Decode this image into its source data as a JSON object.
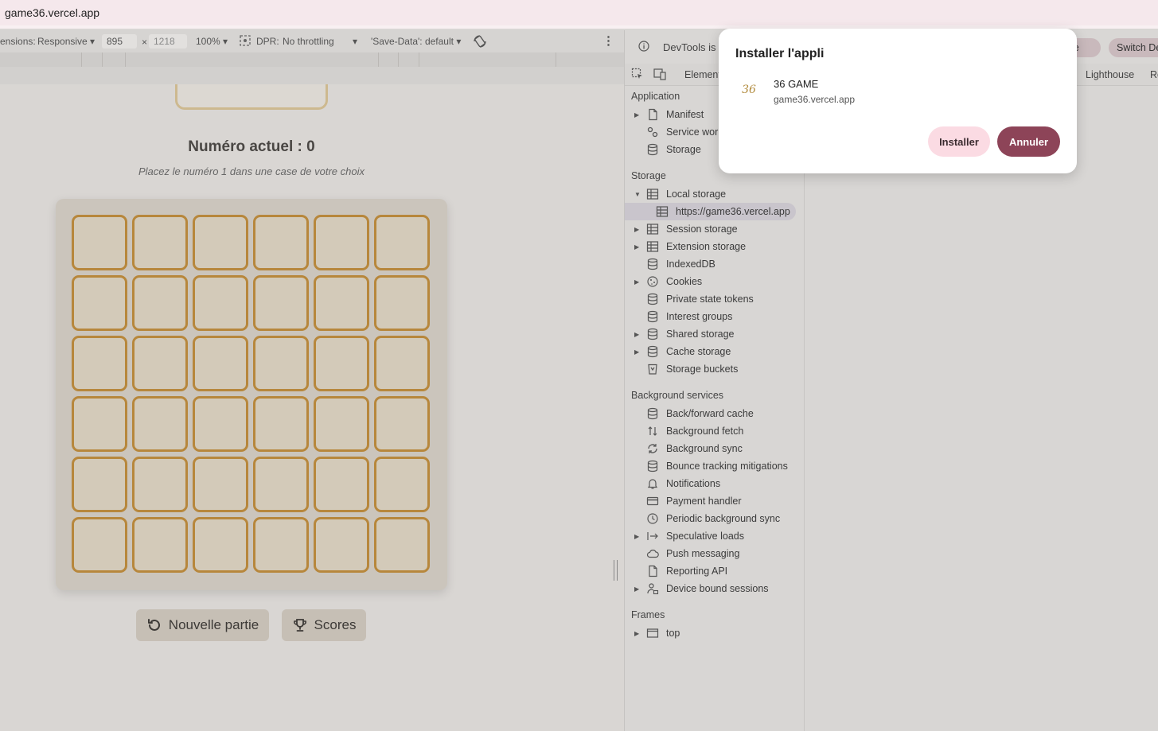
{
  "browser": {
    "url": "game36.vercel.app"
  },
  "emulation": {
    "dimensions_label": "ensions:",
    "device": "Responsive",
    "width": "895",
    "times": "×",
    "height": "1218",
    "zoom": "100%",
    "dpr_label": "DPR:",
    "throttling": "No throttling",
    "save_data": "'Save-Data': default"
  },
  "game": {
    "current_number": "Numéro actuel : 0",
    "instruction": "Placez le numéro 1 dans une case de votre choix",
    "grid_rows": 6,
    "grid_cols": 6,
    "new_game_label": "Nouvelle partie",
    "scores_label": "Scores"
  },
  "devtools": {
    "notice": "DevTools is r",
    "pill_1": "age",
    "pill_2": "Switch De",
    "tabs": {
      "elements": "Element",
      "lighthouse": "Lighthouse",
      "more": "Re"
    },
    "sections": {
      "application": "Application",
      "storage": "Storage",
      "background": "Background services",
      "frames": "Frames"
    },
    "application_items": [
      {
        "label": "Manifest",
        "icon": "file-icon",
        "arrow": true
      },
      {
        "label": "Service work",
        "icon": "gears-icon",
        "arrow": false
      },
      {
        "label": "Storage",
        "icon": "database-icon",
        "arrow": false
      }
    ],
    "storage_items": [
      {
        "label": "Local storage",
        "icon": "table-icon",
        "arrow": "open"
      },
      {
        "label": "https://game36.vercel.app",
        "icon": "table-icon",
        "arrow": false,
        "child": true,
        "selected": true
      },
      {
        "label": "Session storage",
        "icon": "table-icon",
        "arrow": true
      },
      {
        "label": "Extension storage",
        "icon": "table-icon",
        "arrow": true
      },
      {
        "label": "IndexedDB",
        "icon": "database-icon",
        "arrow": false
      },
      {
        "label": "Cookies",
        "icon": "cookie-icon",
        "arrow": true
      },
      {
        "label": "Private state tokens",
        "icon": "database-icon",
        "arrow": false
      },
      {
        "label": "Interest groups",
        "icon": "database-icon",
        "arrow": false
      },
      {
        "label": "Shared storage",
        "icon": "database-icon",
        "arrow": true
      },
      {
        "label": "Cache storage",
        "icon": "database-icon",
        "arrow": true
      },
      {
        "label": "Storage buckets",
        "icon": "bucket-icon",
        "arrow": false
      }
    ],
    "background_items": [
      {
        "label": "Back/forward cache",
        "icon": "database-icon",
        "arrow": false
      },
      {
        "label": "Background fetch",
        "icon": "updown-arrows-icon",
        "arrow": false
      },
      {
        "label": "Background sync",
        "icon": "sync-icon",
        "arrow": false
      },
      {
        "label": "Bounce tracking mitigations",
        "icon": "database-icon",
        "arrow": false
      },
      {
        "label": "Notifications",
        "icon": "bell-icon",
        "arrow": false
      },
      {
        "label": "Payment handler",
        "icon": "card-icon",
        "arrow": false
      },
      {
        "label": "Periodic background sync",
        "icon": "clock-icon",
        "arrow": false
      },
      {
        "label": "Speculative loads",
        "icon": "arrow-right-bar-icon",
        "arrow": true
      },
      {
        "label": "Push messaging",
        "icon": "cloud-icon",
        "arrow": false
      },
      {
        "label": "Reporting API",
        "icon": "file-icon",
        "arrow": false
      },
      {
        "label": "Device bound sessions",
        "icon": "lock-person-icon",
        "arrow": true
      }
    ],
    "frames_items": [
      {
        "label": "top",
        "icon": "frame-icon",
        "arrow": true
      }
    ]
  },
  "install_dialog": {
    "title": "Installer l'appli",
    "app_icon_text": "36",
    "app_name": "36 GAME",
    "app_url": "game36.vercel.app",
    "install_label": "Installer",
    "cancel_label": "Annuler"
  }
}
